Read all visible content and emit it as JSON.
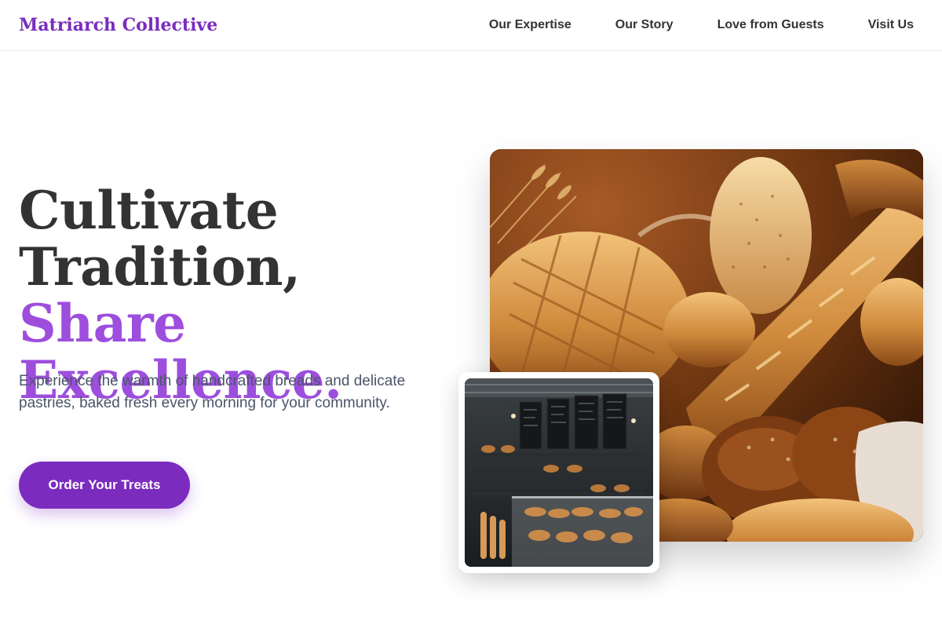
{
  "header": {
    "brand": "Matriarch Collective",
    "nav": [
      {
        "label": "Our Expertise"
      },
      {
        "label": "Our Story"
      },
      {
        "label": "Love from Guests"
      },
      {
        "label": "Visit Us"
      }
    ]
  },
  "hero": {
    "title_line1": "Cultivate",
    "title_line2": "Tradition,",
    "title_accent1": "Share",
    "title_accent2": "Excellence.",
    "subtitle": "Experience the warmth of handcrafted breads and delicate pastries, baked fresh every morning for your community.",
    "cta_label": "Order Your Treats"
  },
  "colors": {
    "brand": "#7b2cbf",
    "accent": "#9d4edd",
    "heading": "#333333",
    "body_text": "#4a5568"
  }
}
